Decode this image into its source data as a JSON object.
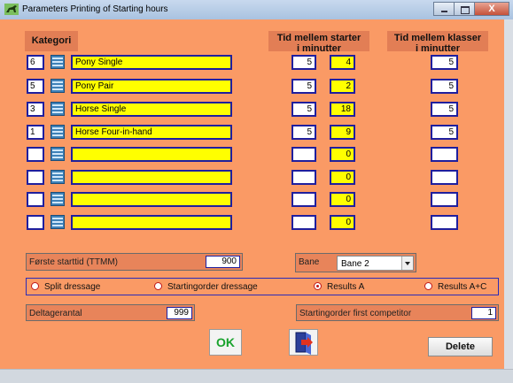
{
  "window": {
    "title": "Parameters Printing of Starting hours"
  },
  "headers": {
    "kategori": "Kategori",
    "tid_starter_line1": "Tid mellem starter",
    "tid_starter_line2": "i minutter",
    "tid_klasser_line1": "Tid mellem klasser",
    "tid_klasser_line2": "i minutter"
  },
  "rows": [
    {
      "num": "6",
      "name": "Pony Single",
      "start": "5",
      "yellow": "4",
      "klasser": "5"
    },
    {
      "num": "5",
      "name": "Pony Pair",
      "start": "5",
      "yellow": "2",
      "klasser": "5"
    },
    {
      "num": "3",
      "name": "Horse Single",
      "start": "5",
      "yellow": "18",
      "klasser": "5"
    },
    {
      "num": "1",
      "name": "Horse Four-in-hand",
      "start": "5",
      "yellow": "9",
      "klasser": "5"
    },
    {
      "num": "",
      "name": "",
      "start": "",
      "yellow": "0",
      "klasser": ""
    },
    {
      "num": "",
      "name": "",
      "start": "",
      "yellow": "0",
      "klasser": ""
    },
    {
      "num": "",
      "name": "",
      "start": "",
      "yellow": "0",
      "klasser": ""
    },
    {
      "num": "",
      "name": "",
      "start": "",
      "yellow": "0",
      "klasser": ""
    }
  ],
  "forste_starttid": {
    "label": "Første starttid (TTMM)",
    "value": "900"
  },
  "bane": {
    "label": "Bane",
    "value": "Bane 2"
  },
  "options": [
    {
      "label": "Split dressage",
      "selected": false
    },
    {
      "label": "Startingorder dressage",
      "selected": false
    },
    {
      "label": "Results A",
      "selected": true
    },
    {
      "label": "Results A+C",
      "selected": false
    }
  ],
  "deltagerantal": {
    "label": "Deltagerantal",
    "value": "999"
  },
  "startingorder_first": {
    "label": "Startingorder first competitor",
    "value": "1"
  },
  "buttons": {
    "ok": "OK",
    "delete": "Delete",
    "exit_icon": "exit-door-icon"
  },
  "window_buttons": {
    "close": "X"
  },
  "colors": {
    "panel": "#fa9a65",
    "field_border": "#1f1f9e",
    "highlight": "#ffff00",
    "ok_green": "#18a22c"
  }
}
